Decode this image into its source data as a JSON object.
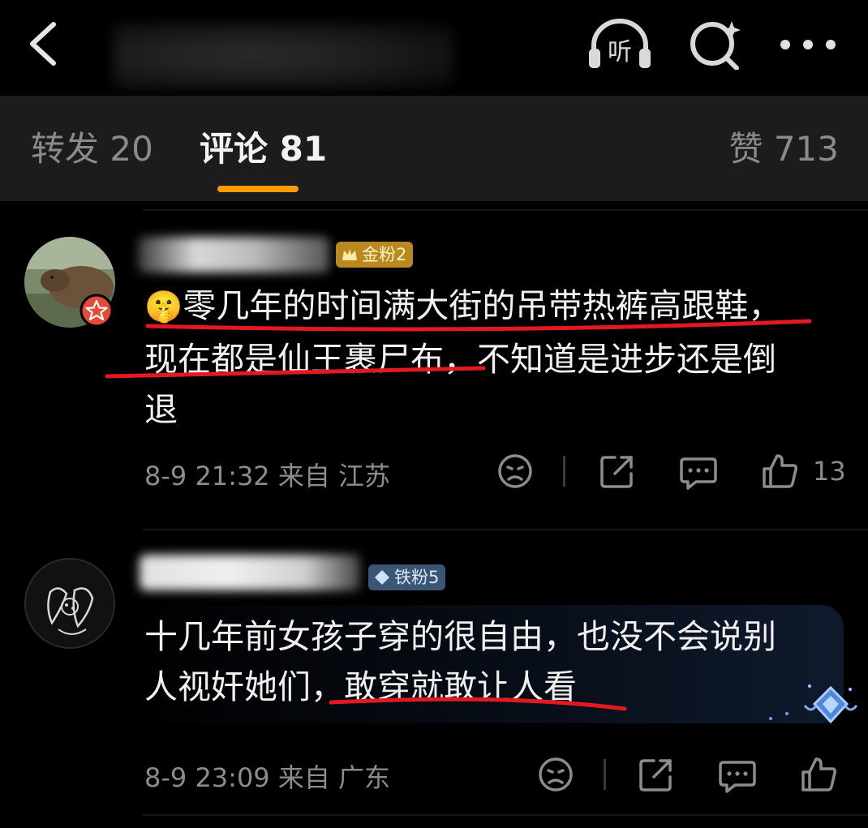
{
  "tabs": {
    "repost": "转发 20",
    "comment": "评论 81",
    "like": "赞 713"
  },
  "header": {
    "listen_label": "听"
  },
  "comments": [
    {
      "badge": "金粉2",
      "emoji": "🤫",
      "lines": [
        "零几年的时间满大街的吊带热裤高跟鞋，",
        "现在都是仙王裹尸布，不知道是进步还是倒",
        "退"
      ],
      "time_location": "8-9 21:32 来自 江苏",
      "likes": "13"
    },
    {
      "badge": "铁粉5",
      "lines": [
        "十几年前女孩子穿的很自由，也没不会说别",
        "人视奸她们，敢穿就敢让人看"
      ],
      "time_location": "8-9 23:09 来自 广东",
      "likes": ""
    }
  ],
  "colors": {
    "accent_orange": "#ff9a00",
    "annotation_red": "#e11a22",
    "gold_badge": "#b8891e",
    "iron_badge": "#3b5674"
  }
}
